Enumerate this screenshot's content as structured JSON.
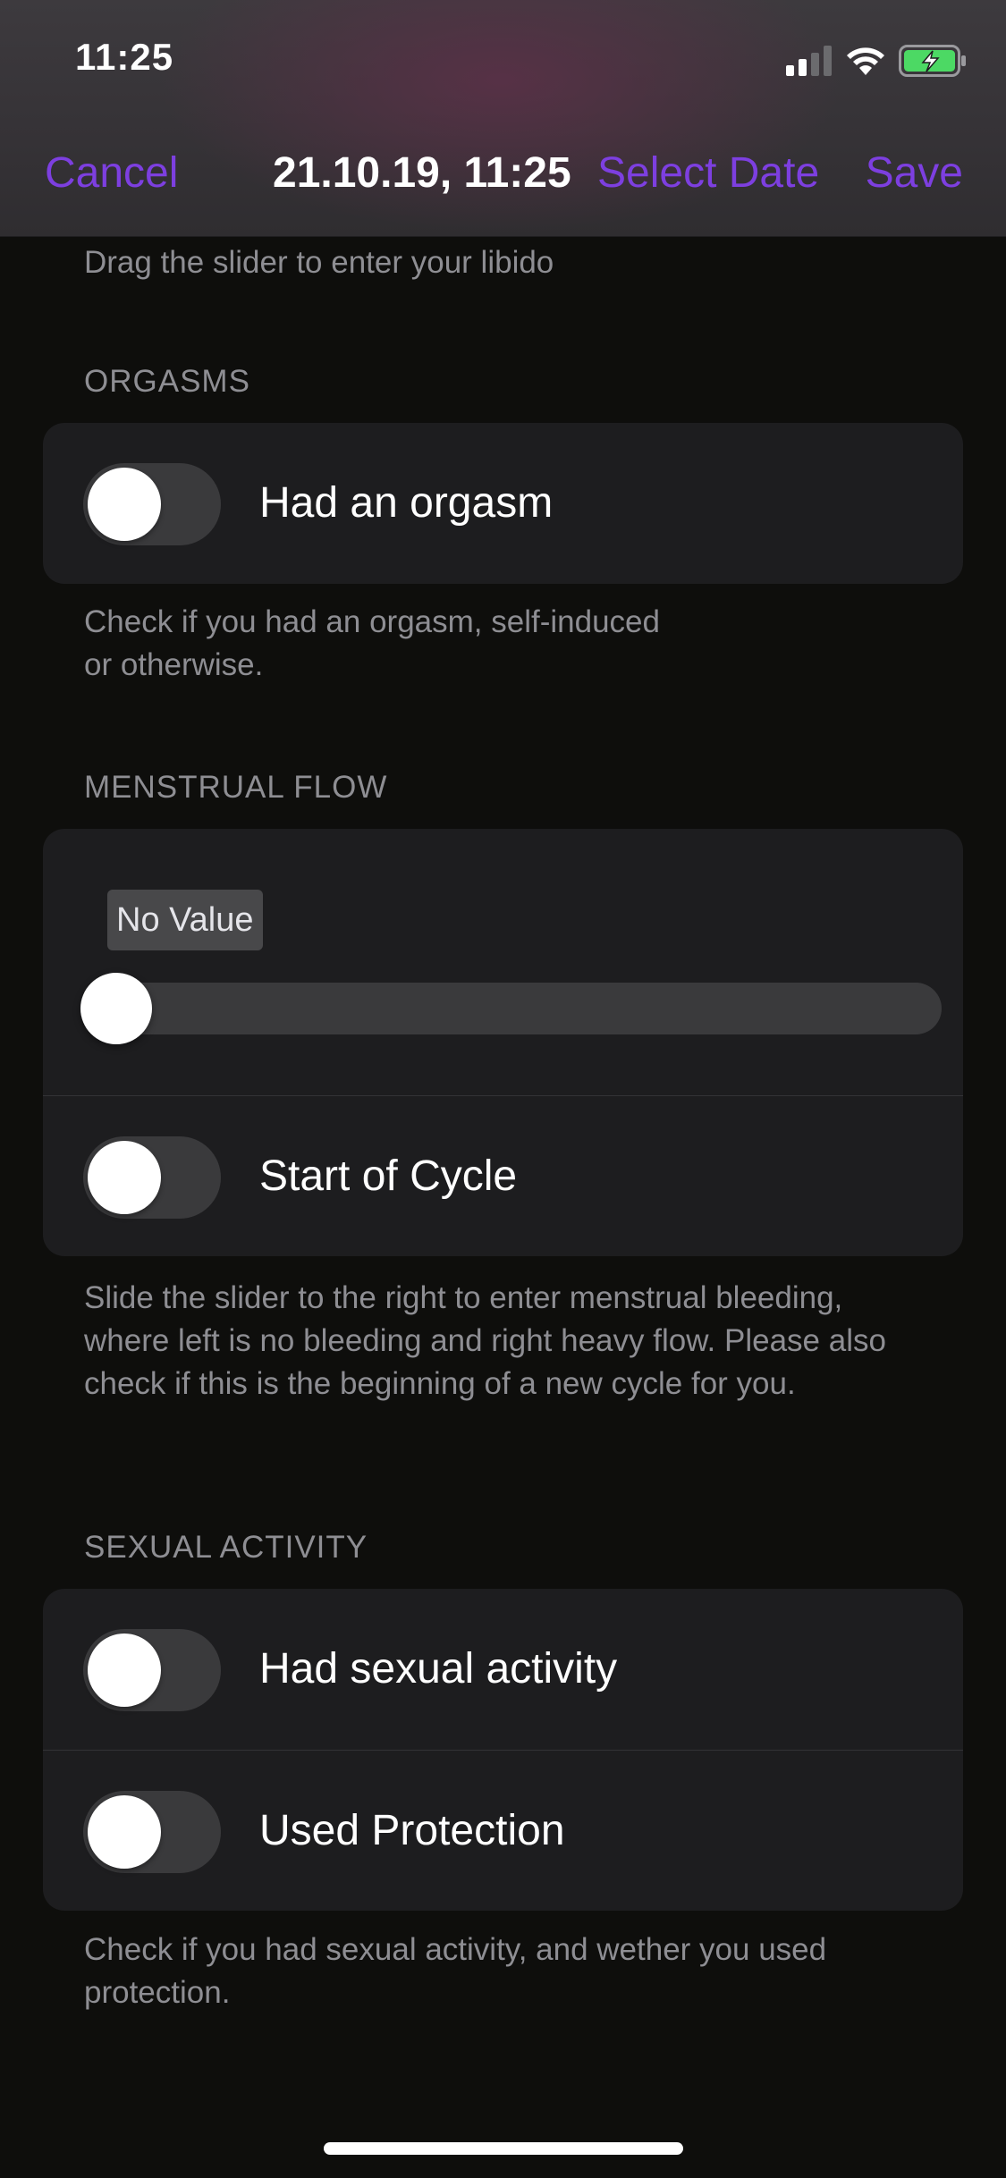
{
  "status_bar": {
    "time": "11:25",
    "icons": [
      "cellular-signal-icon",
      "wifi-icon",
      "battery-charging-icon"
    ]
  },
  "nav": {
    "cancel_label": "Cancel",
    "title": "21.10.19, 11:25",
    "select_date_label": "Select Date",
    "save_label": "Save"
  },
  "libido": {
    "footer": "Drag the slider to enter your libido"
  },
  "orgasms": {
    "header": "ORGASMS",
    "rows": [
      {
        "label": "Had an orgasm",
        "on": false
      }
    ],
    "footer_line1": "Check if you had an orgasm, self-induced",
    "footer_line2": "or otherwise."
  },
  "menstrual_flow": {
    "header": "MENSTRUAL FLOW",
    "slider": {
      "value_label": "No Value",
      "value": 0
    },
    "rows": [
      {
        "label": "Start of Cycle",
        "on": false
      }
    ],
    "footer": "Slide the slider to the right to enter menstrual bleeding, where left is no bleeding and right heavy flow. Please also check if this is the beginning of a new cycle for you."
  },
  "sexual_activity": {
    "header": "SEXUAL ACTIVITY",
    "rows": [
      {
        "label": "Had sexual activity",
        "on": false
      },
      {
        "label": "Used Protection",
        "on": false
      }
    ],
    "footer": "Check if you had sexual activity, and wether you used protection."
  },
  "colors": {
    "accent": "#7d3fe0",
    "background": "#0e0e0c",
    "card": "#1d1d1f",
    "secondary_text": "#8e8e93",
    "battery": "#4cd964"
  }
}
